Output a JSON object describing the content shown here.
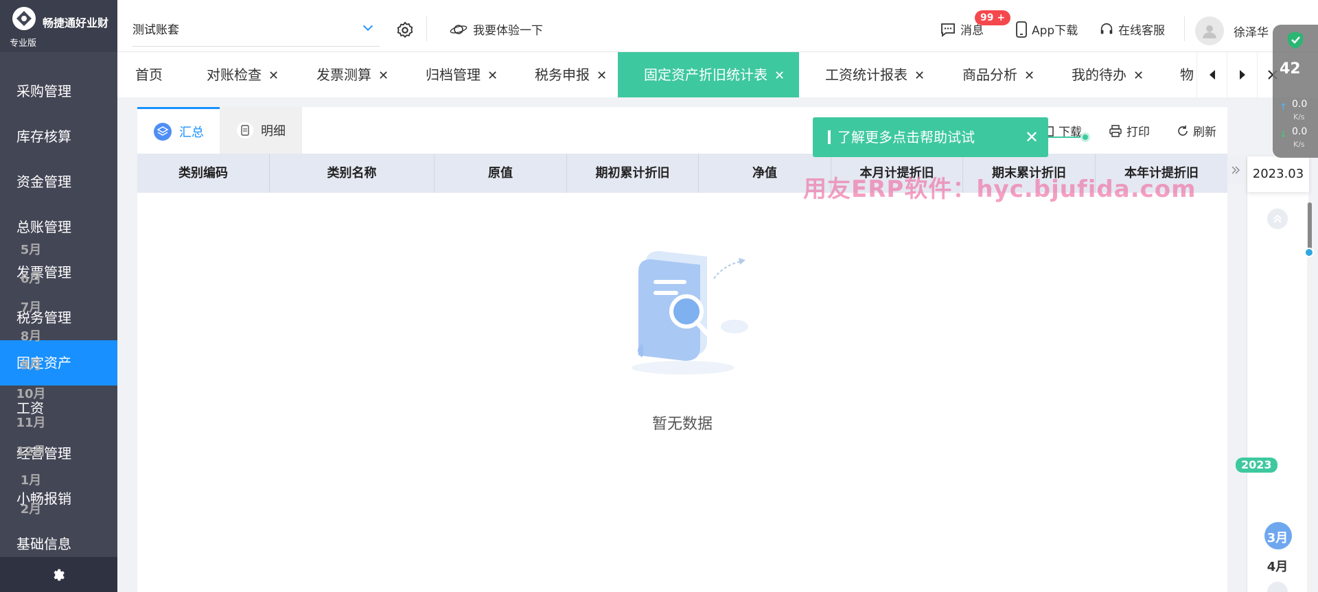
{
  "brand": {
    "name": "畅捷通好业财",
    "edition": "专业版"
  },
  "sidebar": {
    "items": [
      {
        "label": "采购管理"
      },
      {
        "label": "库存核算"
      },
      {
        "label": "资金管理"
      },
      {
        "label": "总账管理"
      },
      {
        "label": "发票管理"
      },
      {
        "label": "税务管理"
      },
      {
        "label": "固定资产",
        "active": true
      },
      {
        "label": "工资"
      },
      {
        "label": "经营管理"
      },
      {
        "label": "小畅报销"
      },
      {
        "label": "基础信息"
      }
    ]
  },
  "topbar": {
    "account_value": "测试账套",
    "try_label": "我要体验一下",
    "messages_label": "消息",
    "messages_badge": "99 +",
    "app_download_label": "App下载",
    "support_label": "在线客服",
    "username": "徐泽华"
  },
  "tabs": [
    {
      "label": "首页",
      "closable": false
    },
    {
      "label": "对账检查",
      "closable": true
    },
    {
      "label": "发票测算",
      "closable": true
    },
    {
      "label": "归档管理",
      "closable": true
    },
    {
      "label": "税务申报",
      "closable": true
    },
    {
      "label": "固定资产折旧统计表",
      "closable": true,
      "active": true
    },
    {
      "label": "工资统计报表",
      "closable": true
    },
    {
      "label": "商品分析",
      "closable": true
    },
    {
      "label": "我的待办",
      "closable": true
    },
    {
      "label": "物",
      "closable": false
    }
  ],
  "view_tabs": [
    {
      "label": "汇总",
      "active": true
    },
    {
      "label": "明细",
      "active": false
    }
  ],
  "toolbar": {
    "download_label": "下载",
    "print_label": "打印",
    "refresh_label": "刷新"
  },
  "toast": {
    "text": "了解更多点击帮助试试"
  },
  "table": {
    "columns": [
      "类别编码",
      "类别名称",
      "原值",
      "期初累计折旧",
      "净值",
      "本月计提折旧",
      "期末累计折旧",
      "本年计提折旧"
    ],
    "rows": []
  },
  "empty_text": "暂无数据",
  "watermark": "用友ERP软件：hyc.bjufida.com",
  "period": {
    "current": "2023.03",
    "year_tag": "2023",
    "months": [
      "5月",
      "6月",
      "7月",
      "8月",
      "9月",
      "10月",
      "11月",
      "12月",
      "1月",
      "2月",
      "3月",
      "4月"
    ],
    "selected": "3月"
  },
  "netmon": {
    "value": "42",
    "up": "0.0",
    "down": "0.0",
    "unit": "K/s"
  },
  "colors": {
    "accent": "#1890ff",
    "tab_active": "#3ec8a0",
    "sidebar": "#434655",
    "badge": "#f5484d"
  }
}
